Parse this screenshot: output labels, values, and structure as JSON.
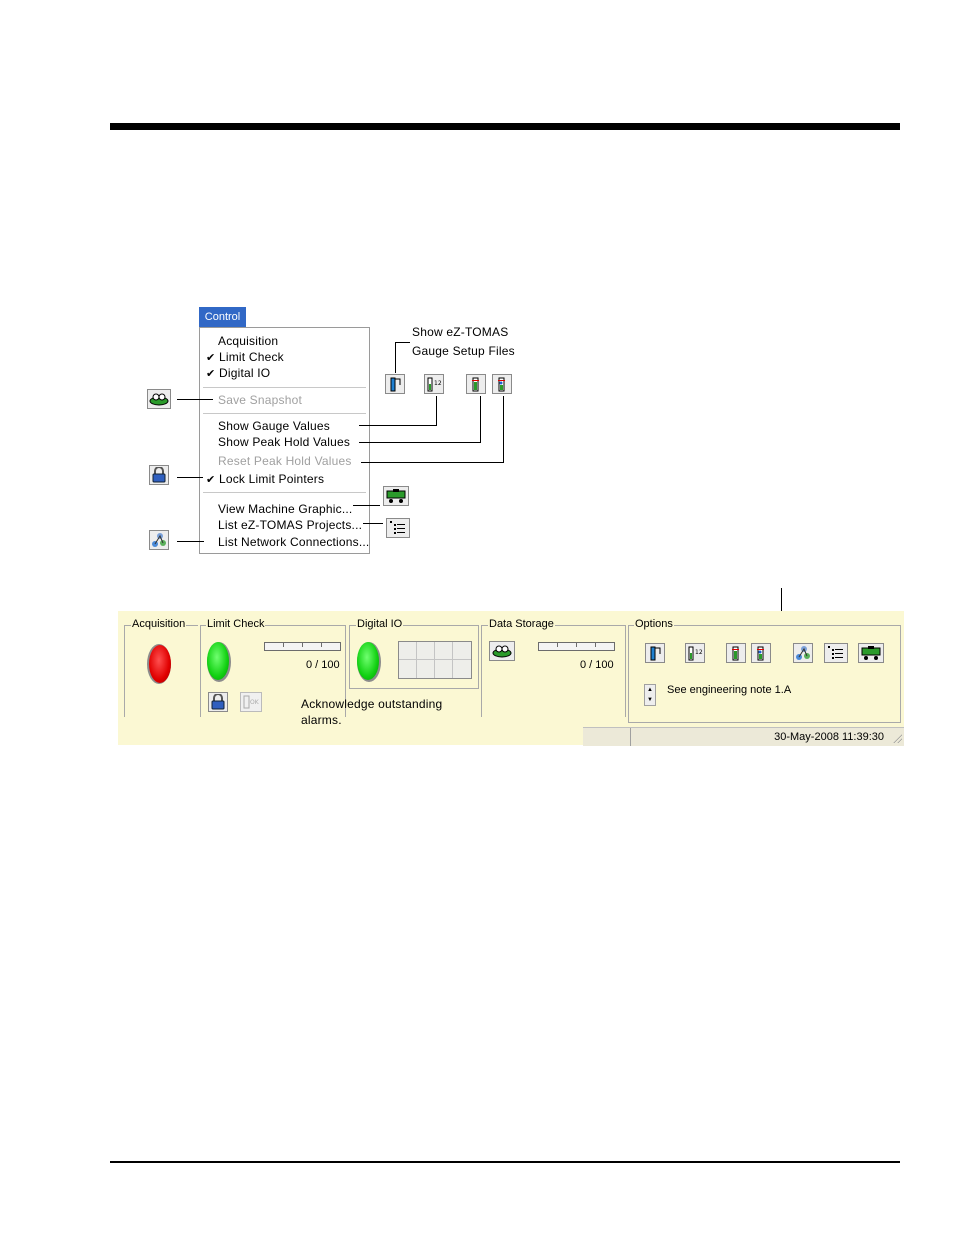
{
  "menu": {
    "title": "Control",
    "items": [
      {
        "label": "Acquisition",
        "checked": false,
        "disabled": false
      },
      {
        "label": "Limit Check",
        "checked": true,
        "disabled": false
      },
      {
        "label": "Digital IO",
        "checked": true,
        "disabled": false
      },
      {
        "label": "Save Snapshot",
        "checked": false,
        "disabled": true
      },
      {
        "label": "Show Gauge Values",
        "checked": false,
        "disabled": false
      },
      {
        "label": "Show Peak Hold Values",
        "checked": false,
        "disabled": false
      },
      {
        "label": "Reset Peak Hold Values",
        "checked": false,
        "disabled": true
      },
      {
        "label": "Lock Limit Pointers",
        "checked": true,
        "disabled": false
      },
      {
        "label": "View Machine Graphic...",
        "checked": false,
        "disabled": false
      },
      {
        "label": "List eZ-TOMAS Projects...",
        "checked": false,
        "disabled": false
      },
      {
        "label": "List Network Connections...",
        "checked": false,
        "disabled": false
      }
    ],
    "check_glyph": "✔"
  },
  "callouts": {
    "gauge_setup_line1": "Show eZ-TOMAS",
    "gauge_setup_line2": "Gauge Setup Files",
    "acknowledge_line1": "Acknowledge outstanding",
    "acknowledge_line2": "alarms."
  },
  "strip": {
    "acquisition_label": "Acquisition",
    "limit_check_label": "Limit Check",
    "limit_check_count": "0 / 100",
    "digital_io_label": "Digital IO",
    "data_storage_label": "Data Storage",
    "data_storage_count": "0 / 100",
    "options_label": "Options",
    "engineering_note": "See engineering note 1.A",
    "status_datetime": "30-May-2008 11:39:30"
  },
  "colors": {
    "menu_title_bg": "#3168c6",
    "strip_bg": "#fbf8d3",
    "led_red": "#e00000",
    "led_green": "#10d010"
  },
  "icons": [
    "snapshot-icon",
    "lock-icon",
    "network-icon",
    "gauge-setup-icon",
    "gauge-values-icon",
    "peak-hold-icon",
    "reset-peak-icon",
    "machine-graphic-icon",
    "projects-list-icon",
    "alarm-ack-icon"
  ]
}
